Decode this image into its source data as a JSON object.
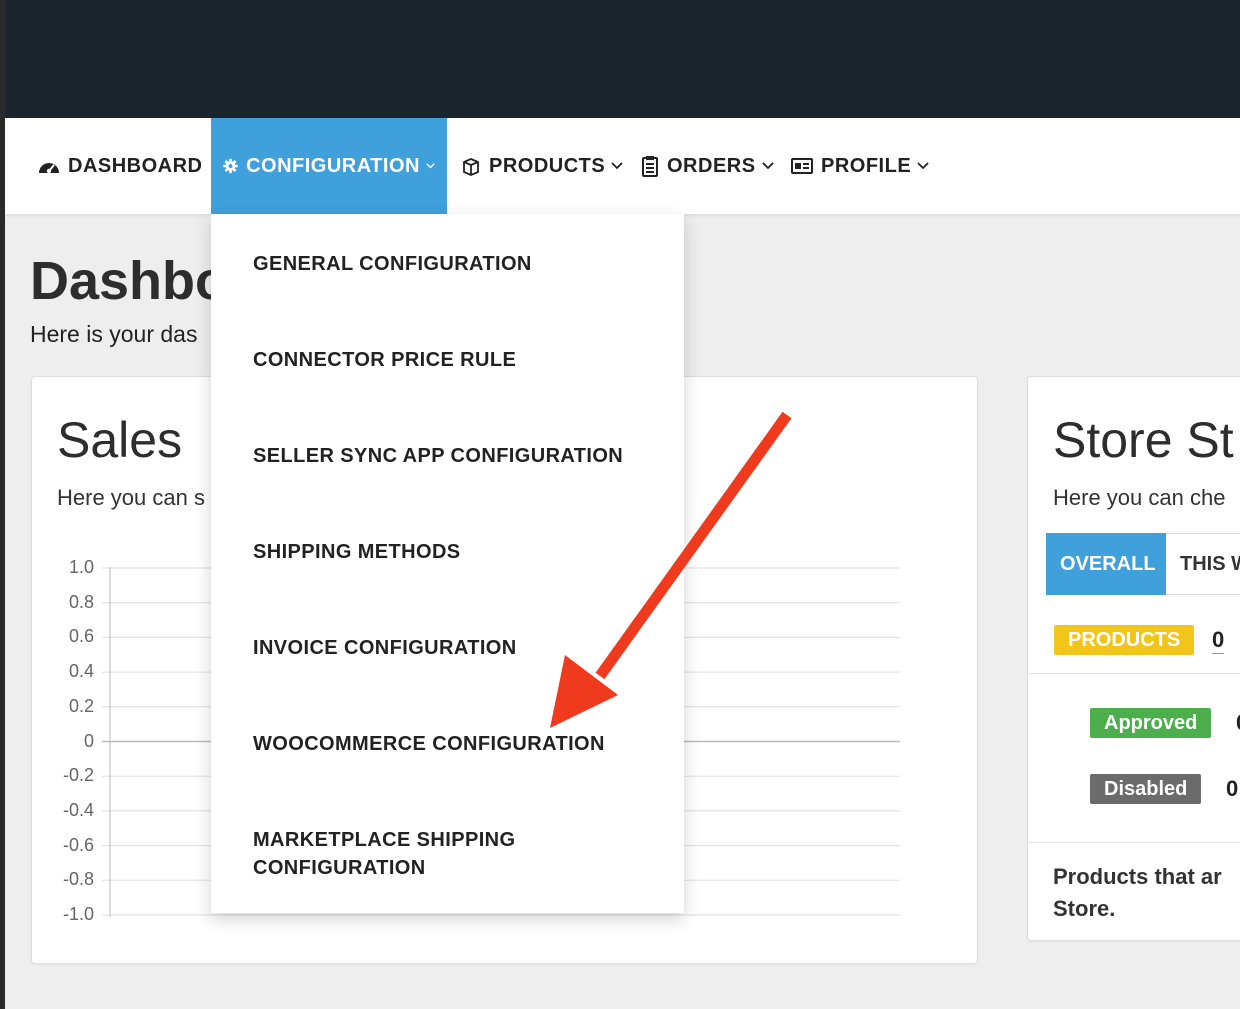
{
  "header": {
    "title": ""
  },
  "nav": {
    "items": [
      {
        "label": "DASHBOARD",
        "icon": "dashboard-gauge-icon"
      },
      {
        "label": "CONFIGURATION",
        "icon": "gear-icon",
        "active": true
      },
      {
        "label": "PRODUCTS",
        "icon": "box-icon"
      },
      {
        "label": "ORDERS",
        "icon": "clipboard-icon"
      },
      {
        "label": "PROFILE",
        "icon": "id-card-icon"
      }
    ]
  },
  "dropdown": {
    "items": [
      "GENERAL CONFIGURATION",
      "CONNECTOR PRICE RULE",
      "SELLER SYNC APP CONFIGURATION",
      "SHIPPING METHODS",
      "INVOICE CONFIGURATION",
      "WOOCOMMERCE CONFIGURATION",
      "MARKETPLACE SHIPPING CONFIGURATION"
    ]
  },
  "page": {
    "title": "Dashbo",
    "subtitle": "Here is your das"
  },
  "sales": {
    "title": "Sales",
    "subtitle": "Here you can s",
    "y_ticks": [
      "1.0",
      "0.8",
      "0.6",
      "0.4",
      "0.2",
      "0",
      "-0.2",
      "-0.4",
      "-0.6",
      "-0.8",
      "-1.0"
    ]
  },
  "store": {
    "title": "Store St",
    "subtitle": "Here you can che",
    "tabs": [
      "OVERALL",
      "THIS W"
    ],
    "products_label": "PRODUCTS",
    "products_count": "0",
    "approved_label": "Approved",
    "approved_count": "0",
    "disabled_label": "Disabled",
    "disabled_count": "0",
    "footer_line1": "Products that ar",
    "footer_line2": "Store."
  },
  "colors": {
    "topbar": "#1b252d",
    "accent": "#40a0dc",
    "products_badge": "#f2c51b",
    "approved_badge": "#4cae4c",
    "disabled_badge": "#6b6b6b",
    "arrow": "#f03a1e"
  }
}
